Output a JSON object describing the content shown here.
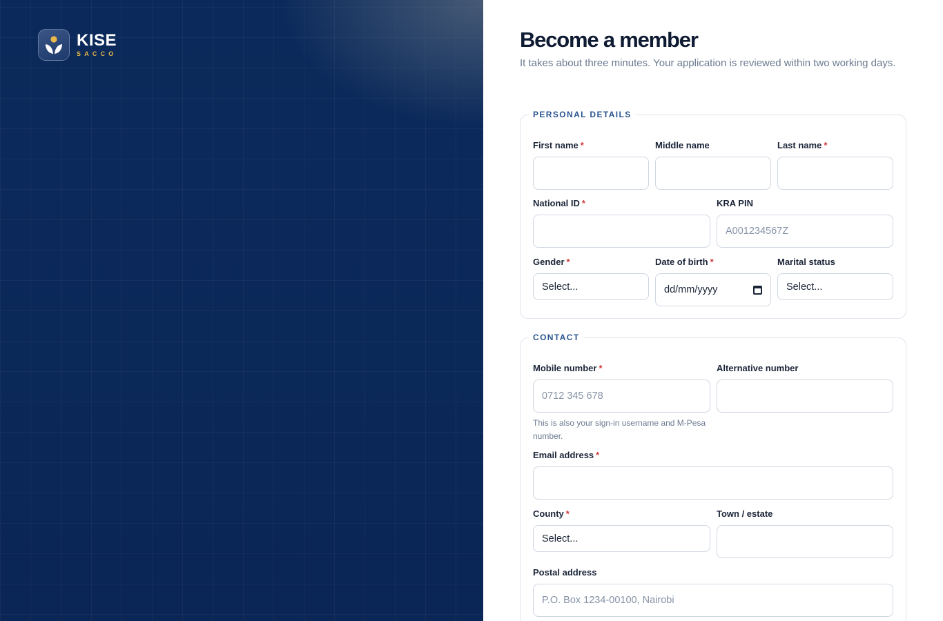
{
  "brand": {
    "name": "KISE",
    "sub": "SACCO",
    "accent": "#e9b949",
    "panel_color": "#0b2a5b"
  },
  "header": {
    "title": "Become a member",
    "subtitle": "It takes about three minutes. Your application is reviewed within two working days."
  },
  "personal": {
    "legend": "PERSONAL DETAILS",
    "first_name": {
      "label": "First name",
      "value": ""
    },
    "middle_name": {
      "label": "Middle name",
      "value": ""
    },
    "last_name": {
      "label": "Last name",
      "value": ""
    },
    "national_id": {
      "label": "National ID",
      "value": ""
    },
    "kra_pin": {
      "label": "KRA PIN",
      "placeholder": "A001234567Z"
    },
    "gender": {
      "label": "Gender",
      "selected": "Select..."
    },
    "dob": {
      "label": "Date of birth",
      "value": "dd/mm/yyyy"
    },
    "marital": {
      "label": "Marital status",
      "selected": "Select..."
    }
  },
  "contact": {
    "legend": "CONTACT",
    "mobile": {
      "label": "Mobile number",
      "placeholder": "0712 345 678",
      "hint": "This is also your sign-in username and M-Pesa number."
    },
    "alt_number": {
      "label": "Alternative number",
      "value": ""
    },
    "email": {
      "label": "Email address",
      "value": ""
    },
    "county": {
      "label": "County",
      "selected": "Select..."
    },
    "town": {
      "label": "Town / estate",
      "value": ""
    },
    "postal": {
      "label": "Postal address",
      "placeholder": "P.O. Box 1234-00100, Nairobi"
    }
  },
  "required_marker": "*",
  "icons": {
    "logo": "sprout-icon",
    "calendar": "calendar-icon"
  }
}
